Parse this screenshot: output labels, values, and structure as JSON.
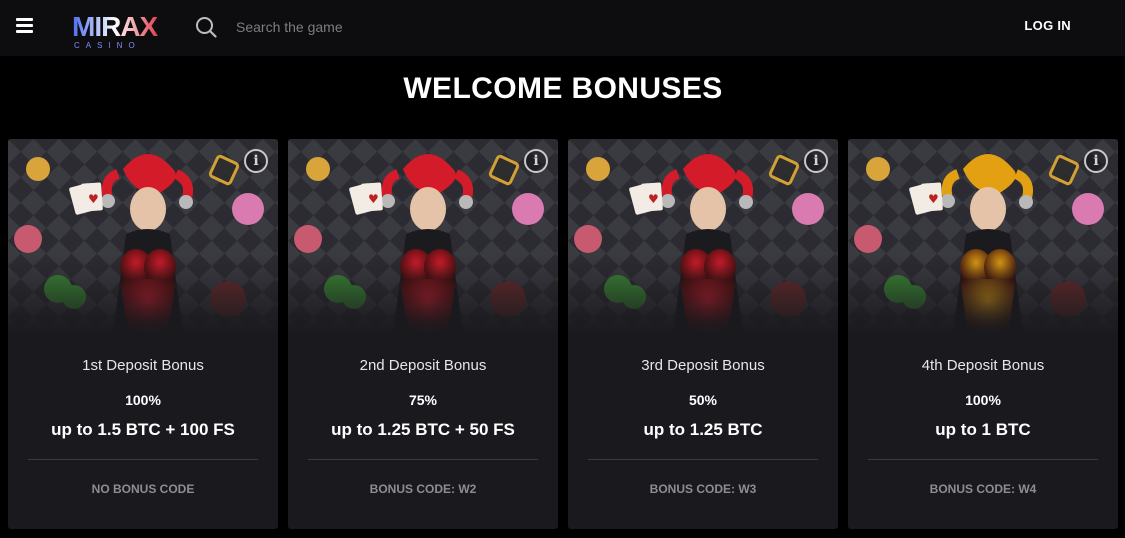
{
  "header": {
    "logo_text": "MIRAX",
    "logo_sub": "CASINO",
    "search_placeholder": "Search the game",
    "login_label": "LOG IN"
  },
  "section": {
    "title": "WELCOME BONUSES"
  },
  "cards": [
    {
      "title": "1st Deposit Bonus",
      "percent": "100%",
      "amount": "up to 1.5 BTC + 100 FS",
      "code": "NO BONUS CODE",
      "info": "i",
      "accent": "#d31b2a"
    },
    {
      "title": "2nd Deposit Bonus",
      "percent": "75%",
      "amount": "up to 1.25 BTC + 50 FS",
      "code": "BONUS CODE: W2",
      "info": "i",
      "accent": "#d31b2a"
    },
    {
      "title": "3rd Deposit Bonus",
      "percent": "50%",
      "amount": "up to 1.25 BTC",
      "code": "BONUS CODE: W3",
      "info": "i",
      "accent": "#d31b2a"
    },
    {
      "title": "4th Deposit Bonus",
      "percent": "100%",
      "amount": "up to 1 BTC",
      "code": "BONUS CODE: W4",
      "info": "i",
      "accent": "#e3a012"
    }
  ],
  "colors": {
    "background": "#000000",
    "card_background": "#1a1a1e",
    "logo_blue": "#3a5de0",
    "logo_red": "#e23a4a"
  }
}
